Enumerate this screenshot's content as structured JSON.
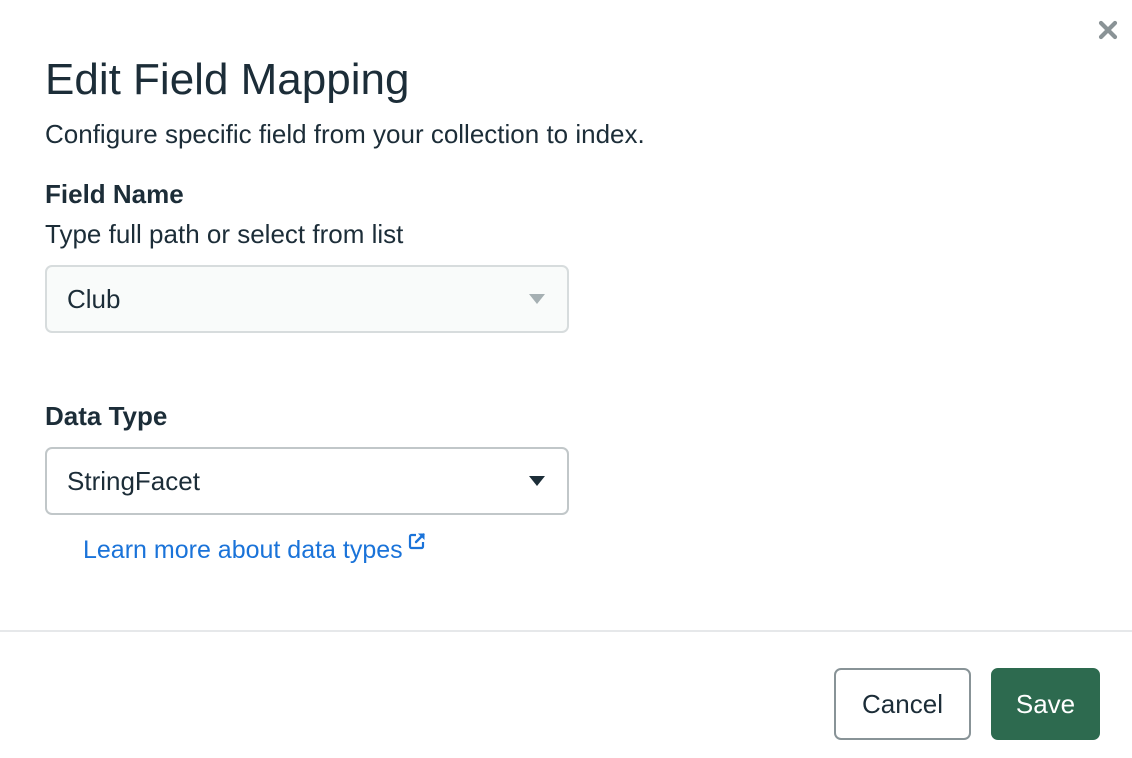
{
  "dialog": {
    "title": "Edit Field Mapping",
    "subtitle": "Configure specific field from your collection to index.",
    "close_icon": "close-icon"
  },
  "field_name": {
    "label": "Field Name",
    "helper": "Type full path or select from list",
    "value": "Club",
    "icon": "caret-down-icon"
  },
  "data_type": {
    "label": "Data Type",
    "value": "StringFacet",
    "icon": "caret-down-icon"
  },
  "learn_more": {
    "text": "Learn more about data types",
    "icon": "external-link-icon"
  },
  "footer": {
    "cancel_label": "Cancel",
    "save_label": "Save"
  },
  "colors": {
    "text": "#1c2d38",
    "link": "#1a73d9",
    "primary": "#2d6a4f",
    "border": "#c1c7c9",
    "divider": "#e6e8ea"
  }
}
